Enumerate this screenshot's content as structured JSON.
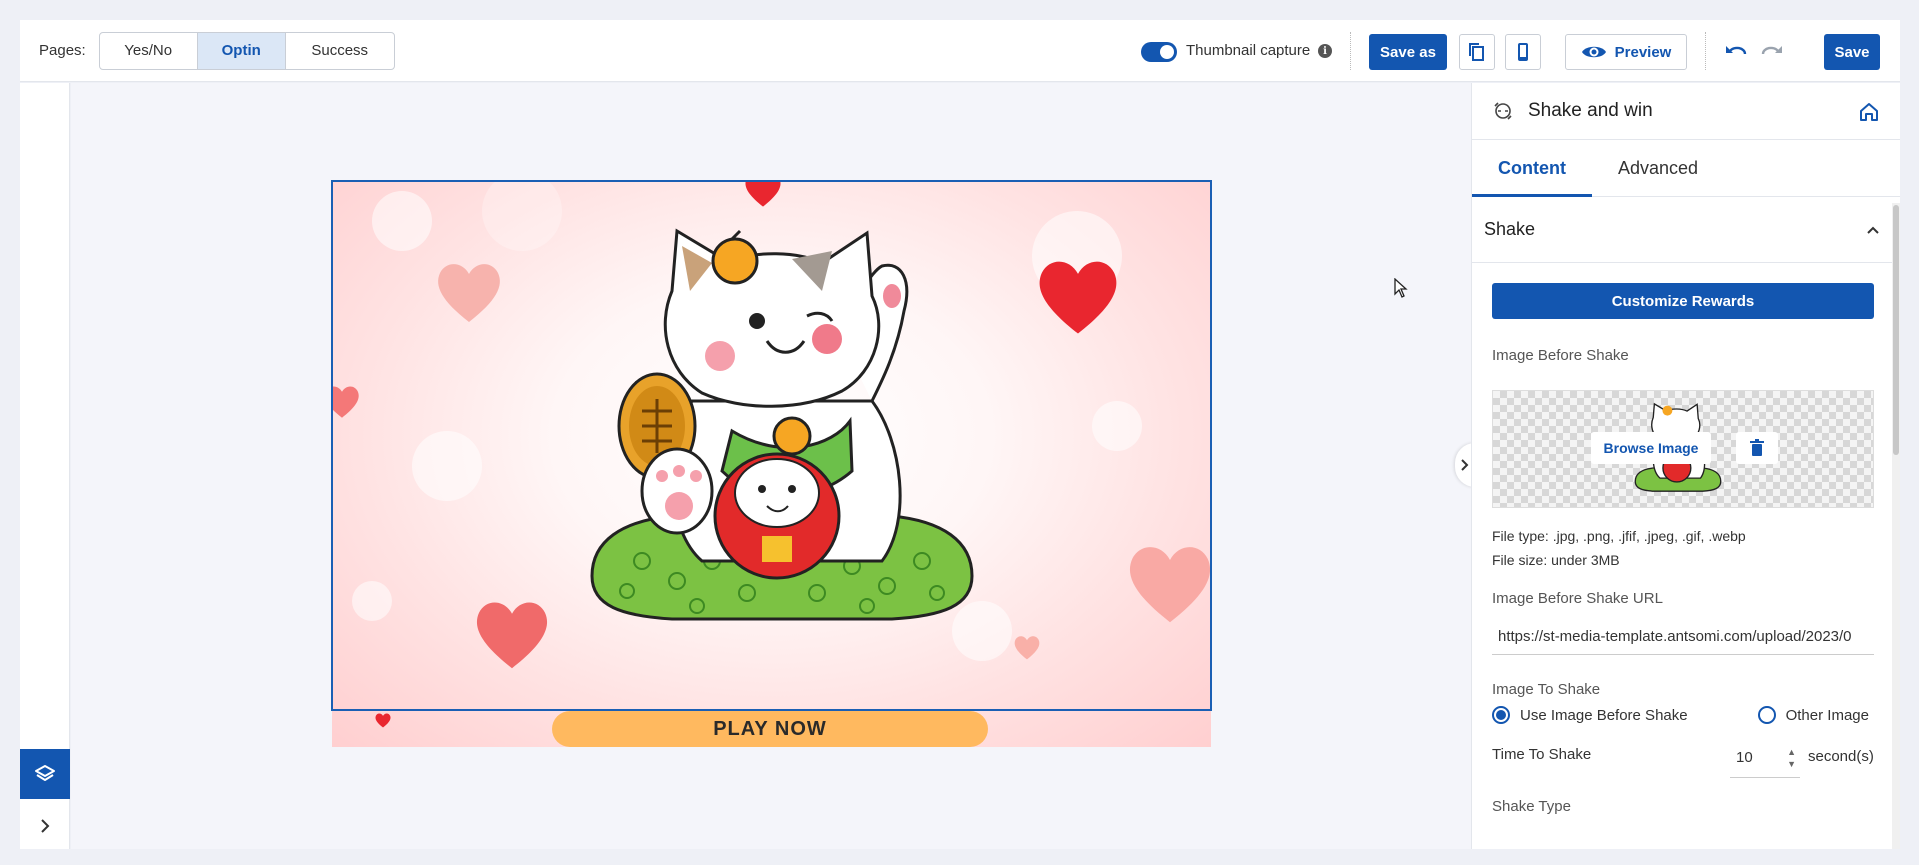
{
  "toolbar": {
    "pages_label": "Pages:",
    "pages": [
      "Yes/No",
      "Optin",
      "Success"
    ],
    "active_page": "Optin",
    "thumbnail_label": "Thumbnail capture",
    "thumbnail_enabled": true,
    "save_as_label": "Save as",
    "preview_label": "Preview",
    "save_label": "Save",
    "icons": [
      "info-icon",
      "duplicate-icon",
      "mobile-icon",
      "eye-icon",
      "undo-icon",
      "redo-icon"
    ]
  },
  "canvas": {
    "play_button_label": "PLAY NOW",
    "image_description_icon": "lucky-cat-illustration"
  },
  "panel": {
    "title": "Shake and win",
    "tabs": [
      "Content",
      "Advanced"
    ],
    "active_tab": "Content",
    "section_title": "Shake",
    "customize_rewards_label": "Customize Rewards",
    "image_before_shake_label": "Image Before Shake",
    "browse_image_label": "Browse Image",
    "file_type_text": "File type: .jpg, .png, .jfif, .jpeg, .gif, .webp",
    "file_size_text": "File size: under 3MB",
    "image_url_label": "Image Before Shake URL",
    "image_url_value": "https://st-media-template.antsomi.com/upload/2023/0",
    "image_to_shake_label": "Image To Shake",
    "image_to_shake_options": [
      "Use Image Before Shake",
      "Other Image"
    ],
    "image_to_shake_selected": "Use Image Before Shake",
    "time_to_shake_label": "Time To Shake",
    "time_to_shake_value": "10",
    "time_to_shake_unit": "second(s)",
    "shake_type_label": "Shake Type"
  },
  "colors": {
    "primary": "#1356b0",
    "play_button": "#ffb95f"
  }
}
